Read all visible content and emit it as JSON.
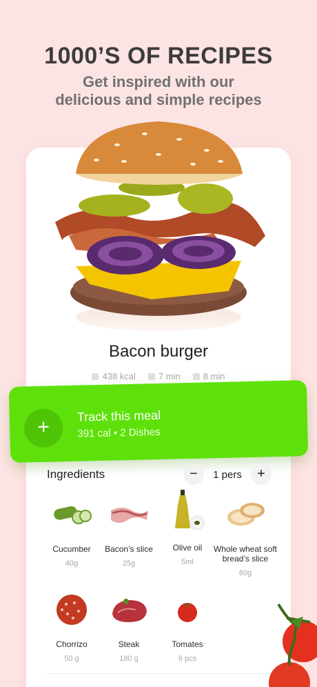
{
  "hero": {
    "title": "1000’S OF RECIPES",
    "subtitle_line1": "Get inspired with our",
    "subtitle_line2": "delicious and simple recipes"
  },
  "dish": {
    "title": "Bacon burger",
    "kcal": "438 kcal",
    "prep": "7 min",
    "cook": "8 min"
  },
  "track": {
    "plus": "+",
    "title": "Track this meal",
    "subtitle": "391 cal • 2 Dishes"
  },
  "ingredients": {
    "heading": "Ingredients",
    "minus": "−",
    "plus": "+",
    "servings": "1 pers",
    "items": [
      {
        "name": "Cucumber",
        "amount": "40g",
        "icon": "cucumber-icon"
      },
      {
        "name": "Bacon’s slice",
        "amount": "25g",
        "icon": "bacon-icon"
      },
      {
        "name": "Olive oil",
        "amount": "5ml",
        "icon": "olive-oil-icon"
      },
      {
        "name": "Whole wheat soft bread’s slice",
        "amount": "60g",
        "icon": "bread-icon"
      },
      {
        "name": "Chorrizo",
        "amount": "50 g",
        "icon": "chorizo-icon"
      },
      {
        "name": "Steak",
        "amount": "180 g",
        "icon": "steak-icon"
      },
      {
        "name": "Tomates",
        "amount": "6 pcs",
        "icon": "tomato-icon"
      }
    ]
  },
  "colors": {
    "background": "#fde4e4",
    "accent_green": "#5ee10a"
  }
}
